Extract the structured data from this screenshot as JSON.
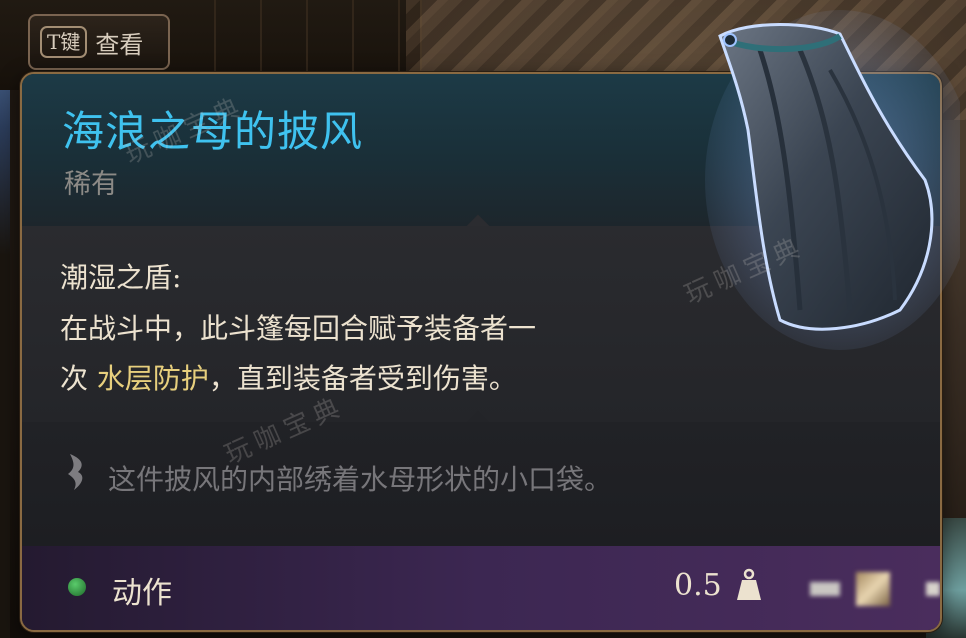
{
  "hotkey": {
    "key": "T键",
    "label": "查看"
  },
  "item": {
    "name": "海浪之母的披风",
    "rarity": "稀有",
    "effect_title": "潮湿之盾:",
    "effect_line1": "在战斗中，此斗篷每回合赋予装备者一",
    "effect_line2_prefix": "次 ",
    "effect_highlight": "水层防护",
    "effect_line2_suffix": "，直到装备者受到伤害。",
    "flavor": "这件披风的内部绣着水母形状的小口袋。"
  },
  "footer": {
    "action_label": "动作",
    "weight": "0.5"
  },
  "watermark": "玩咖宝典",
  "colors": {
    "title": "#3fc2ef",
    "rarity": "#8c8a86",
    "highlight": "#e7cf7d",
    "action_dot": "#3fa84f",
    "border": "#8a6a42"
  },
  "icons": {
    "action": "green-dot-icon",
    "weight": "weight-icon",
    "flavor": "quill-icon",
    "item_art": "cloak-icon"
  }
}
